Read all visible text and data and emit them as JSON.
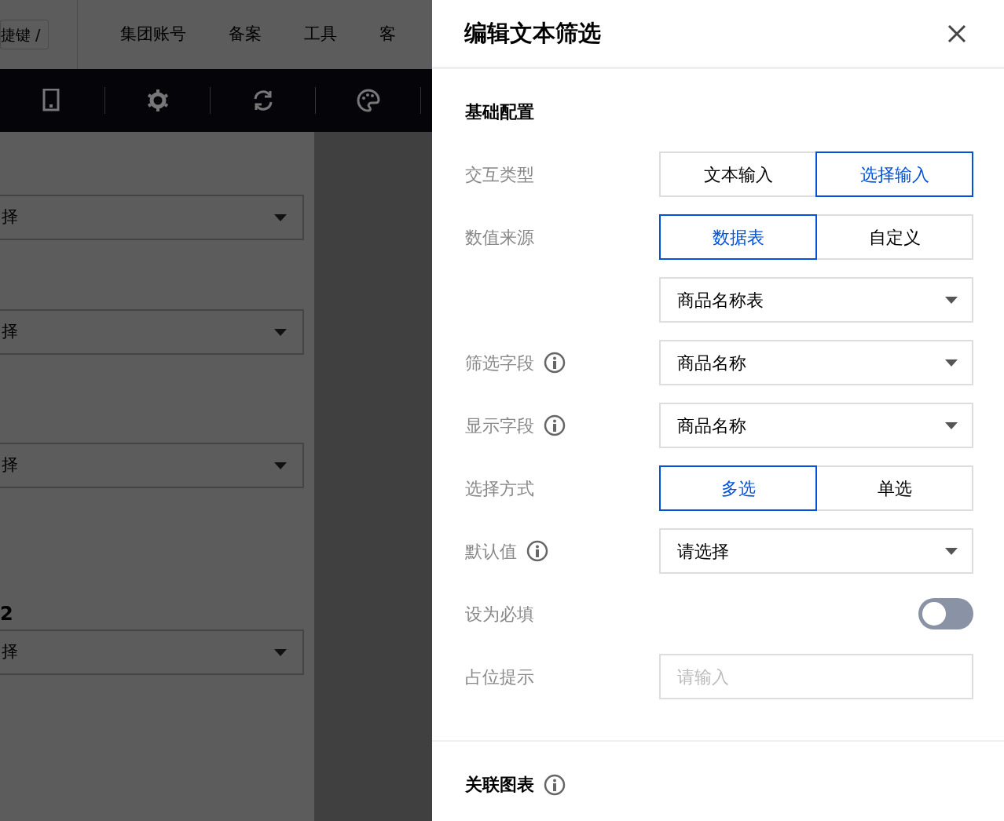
{
  "topnav": {
    "shortcut": "捷键 /",
    "items": [
      "集团账号",
      "备案",
      "工具",
      "客"
    ]
  },
  "canvas": {
    "fields": [
      {
        "placeholder": "择"
      },
      {
        "placeholder": "择"
      },
      {
        "placeholder": "择"
      },
      {
        "label": "2",
        "placeholder": "择"
      }
    ]
  },
  "drawer": {
    "title": "编辑文本筛选",
    "sections": [
      {
        "title": "基础配置",
        "rows": [
          {
            "kind": "segmented",
            "label": "交互类型",
            "options": [
              {
                "label": "文本输入",
                "selected": false
              },
              {
                "label": "选择输入",
                "selected": true
              }
            ]
          },
          {
            "kind": "segmented",
            "label": "数值来源",
            "options": [
              {
                "label": "数据表",
                "selected": true
              },
              {
                "label": "自定义",
                "selected": false
              }
            ]
          },
          {
            "kind": "select",
            "value": "商品名称表"
          },
          {
            "kind": "select",
            "label": "筛选字段",
            "info": true,
            "value": "商品名称"
          },
          {
            "kind": "select",
            "label": "显示字段",
            "info": true,
            "value": "商品名称"
          },
          {
            "kind": "segmented",
            "label": "选择方式",
            "options": [
              {
                "label": "多选",
                "selected": true
              },
              {
                "label": "单选",
                "selected": false
              }
            ]
          },
          {
            "kind": "select",
            "label": "默认值",
            "info": true,
            "value": "请选择"
          },
          {
            "kind": "toggle",
            "label": "设为必填",
            "on": false
          },
          {
            "kind": "input",
            "label": "占位提示",
            "placeholder": "请输入"
          }
        ]
      },
      {
        "title": "关联图表",
        "info": true
      }
    ]
  }
}
